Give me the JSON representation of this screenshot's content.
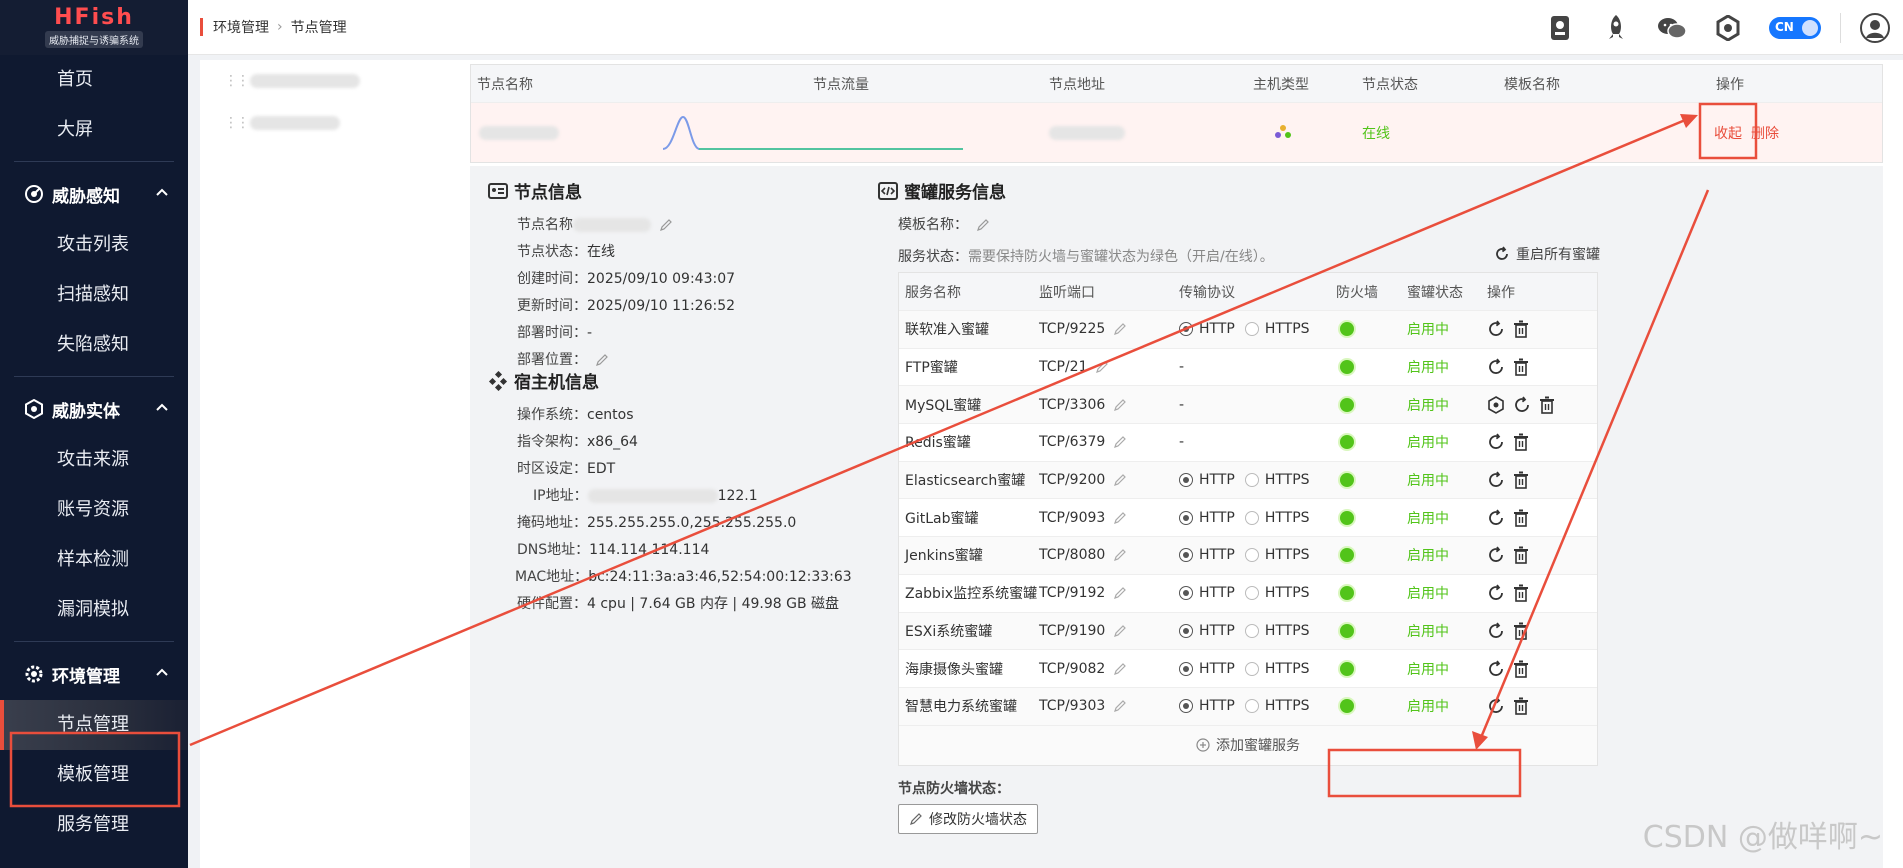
{
  "sidebar": {
    "logo_title": "HFish",
    "logo_subtitle": "威胁捕捉与诱骗系统",
    "top_items": [
      "首页",
      "大屏"
    ],
    "groups": [
      {
        "label": "威胁感知",
        "items": [
          "攻击列表",
          "扫描感知",
          "失陷感知"
        ]
      },
      {
        "label": "威胁实体",
        "items": [
          "攻击来源",
          "账号资源",
          "样本检测",
          "漏洞模拟"
        ]
      },
      {
        "label": "环境管理",
        "items": [
          "节点管理",
          "模板管理",
          "服务管理"
        ]
      }
    ],
    "active_item": "节点管理"
  },
  "header": {
    "breadcrumb": [
      "环境管理",
      "节点管理"
    ],
    "lang_toggle": "CN",
    "icons": [
      "report-icon",
      "rocket-icon",
      "wechat-icon",
      "hexagon-settings-icon",
      "user-avatar-icon"
    ]
  },
  "node_table": {
    "columns": [
      "节点名称",
      "节点流量",
      "节点地址",
      "主机类型",
      "节点状态",
      "模板名称",
      "操作"
    ],
    "row": {
      "status": "在线",
      "actions": [
        "收起",
        "删除"
      ]
    }
  },
  "node_info": {
    "title": "节点信息",
    "fields": [
      {
        "label": "节点名称",
        "value": ""
      },
      {
        "label": "节点状态：",
        "value": "在线"
      },
      {
        "label": "创建时间：",
        "value": "2025/09/10 09:43:07"
      },
      {
        "label": "更新时间：",
        "value": "2025/09/10 11:26:52"
      },
      {
        "label": "部署时间：",
        "value": "-"
      },
      {
        "label": "部署位置：",
        "value": ""
      }
    ]
  },
  "host_info": {
    "title": "宿主机信息",
    "fields": [
      {
        "label": "操作系统：",
        "value": "centos"
      },
      {
        "label": "指令架构：",
        "value": "x86_64"
      },
      {
        "label": "时区设定：",
        "value": "EDT"
      },
      {
        "label": "IP地址：",
        "value": "122.1"
      },
      {
        "label": "掩码地址：",
        "value": "255.255.255.0,255.255.255.0"
      },
      {
        "label": "DNS地址：",
        "value": "114.114.114.114"
      },
      {
        "label": "MAC地址：",
        "value": "bc:24:11:3a:a3:46,52:54:00:12:33:63"
      },
      {
        "label": "硬件配置：",
        "value": "4 cpu | 7.64 GB 内存 | 49.98 GB 磁盘"
      }
    ]
  },
  "honeypot": {
    "title": "蜜罐服务信息",
    "template_label": "模板名称：",
    "status_label": "服务状态：",
    "status_hint": "需要保持防火墙与蜜罐状态为绿色（开启/在线）。",
    "restart_all": "重启所有蜜罐",
    "columns": [
      "服务名称",
      "监听端口",
      "传输协议",
      "防火墙",
      "蜜罐状态",
      "操作"
    ],
    "rows": [
      {
        "name": "联软准入蜜罐",
        "port": "TCP/9225",
        "proto": "radio",
        "state": "启用中",
        "extra": false
      },
      {
        "name": "FTP蜜罐",
        "port": "TCP/21",
        "proto": "-",
        "state": "启用中",
        "extra": false
      },
      {
        "name": "MySQL蜜罐",
        "port": "TCP/3306",
        "proto": "-",
        "state": "启用中",
        "extra": true
      },
      {
        "name": "Redis蜜罐",
        "port": "TCP/6379",
        "proto": "-",
        "state": "启用中",
        "extra": false
      },
      {
        "name": "Elasticsearch蜜罐",
        "port": "TCP/9200",
        "proto": "radio",
        "state": "启用中",
        "extra": false
      },
      {
        "name": "GitLab蜜罐",
        "port": "TCP/9093",
        "proto": "radio",
        "state": "启用中",
        "extra": false
      },
      {
        "name": "Jenkins蜜罐",
        "port": "TCP/8080",
        "proto": "radio",
        "state": "启用中",
        "extra": false
      },
      {
        "name": "Zabbix监控系统蜜罐",
        "port": "TCP/9192",
        "proto": "radio",
        "state": "启用中",
        "extra": false
      },
      {
        "name": "ESXi系统蜜罐",
        "port": "TCP/9190",
        "proto": "radio",
        "state": "启用中",
        "extra": false
      },
      {
        "name": "海康摄像头蜜罐",
        "port": "TCP/9082",
        "proto": "radio",
        "state": "启用中",
        "extra": false
      },
      {
        "name": "智慧电力系统蜜罐",
        "port": "TCP/9303",
        "proto": "radio",
        "state": "启用中",
        "extra": false
      }
    ],
    "proto_http": "HTTP",
    "proto_https": "HTTPS",
    "add_service": "添加蜜罐服务",
    "firewall_label": "节点防火墙状态：",
    "firewall_button": "修改防火墙状态"
  },
  "watermark": "CSDN @做咩啊~",
  "colors": {
    "accent": "#e94e3c",
    "sidebar_bg": "#0f1930",
    "online": "#52c41a",
    "toggle": "#1677ff"
  }
}
